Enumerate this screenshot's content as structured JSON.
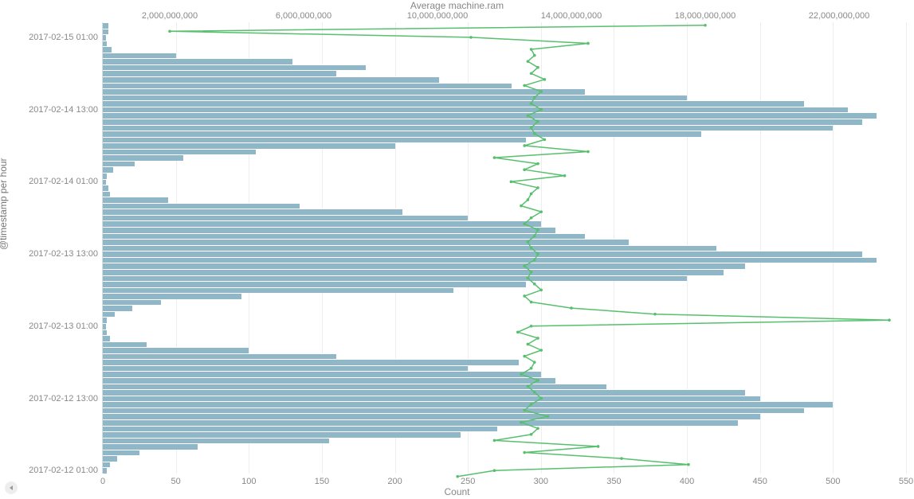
{
  "chart_data": {
    "type": "bar",
    "title_top": "Average machine.ram",
    "title_bottom": "Count",
    "title_y": "@timestamp per hour",
    "x_bottom": {
      "label": "Count",
      "min": 0,
      "max": 550,
      "ticks": [
        0,
        50,
        100,
        150,
        200,
        250,
        300,
        350,
        400,
        450,
        500,
        550
      ]
    },
    "x_top": {
      "label": "Average machine.ram",
      "min": 0,
      "max": 24000000000,
      "ticks": [
        2000000000,
        6000000000,
        10000000000,
        14000000000,
        18000000000,
        22000000000
      ],
      "tick_labels": [
        "2,000,000,000",
        "6,000,000,000",
        "10,000,000,000",
        "14,000,000,000",
        "18,000,000,000",
        "22,000,000,000"
      ]
    },
    "y_ticks": [
      "2017-02-15 01:00",
      "2017-02-14 13:00",
      "2017-02-14 01:00",
      "2017-02-13 13:00",
      "2017-02-13 01:00",
      "2017-02-12 13:00",
      "2017-02-12 01:00"
    ],
    "series": [
      {
        "name": "Count",
        "axis": "bottom",
        "kind": "bar",
        "color": "#90b7c7",
        "values": [
          4,
          4,
          2,
          3,
          6,
          50,
          130,
          180,
          160,
          230,
          280,
          330,
          400,
          480,
          510,
          530,
          520,
          500,
          410,
          290,
          200,
          105,
          55,
          22,
          7,
          3,
          2,
          4,
          5,
          45,
          135,
          205,
          250,
          300,
          310,
          330,
          360,
          420,
          520,
          530,
          440,
          425,
          400,
          290,
          240,
          95,
          40,
          20,
          8,
          3,
          2,
          3,
          5,
          30,
          100,
          160,
          285,
          250,
          300,
          310,
          345,
          440,
          450,
          500,
          480,
          450,
          435,
          270,
          245,
          155,
          65,
          25,
          10,
          5,
          3
        ]
      },
      {
        "name": "Average machine.ram",
        "axis": "top",
        "kind": "line",
        "color": "#57bf6d",
        "values": [
          18000000000,
          2000000000,
          11000000000,
          14500000000,
          12800000000,
          12900000000,
          12700000000,
          13000000000,
          12800000000,
          13200000000,
          12600000000,
          13100000000,
          12900000000,
          12800000000,
          13100000000,
          12700000000,
          13000000000,
          12800000000,
          12900000000,
          13200000000,
          12600000000,
          14500000000,
          11700000000,
          13000000000,
          12600000000,
          13800000000,
          12200000000,
          13000000000,
          12800000000,
          12700000000,
          12500000000,
          13100000000,
          12800000000,
          12600000000,
          13000000000,
          12900000000,
          12700000000,
          12800000000,
          13000000000,
          12900000000,
          12600000000,
          12800000000,
          12700000000,
          12900000000,
          13100000000,
          12600000000,
          12800000000,
          14000000000,
          16500000000,
          23500000000,
          12800000000,
          12400000000,
          13000000000,
          12700000000,
          13100000000,
          12600000000,
          12900000000,
          12800000000,
          12500000000,
          13000000000,
          12700000000,
          12900000000,
          13100000000,
          12800000000,
          12600000000,
          13300000000,
          12500000000,
          13000000000,
          12800000000,
          11700000000,
          14800000000,
          12600000000,
          15500000000,
          17500000000,
          11700000000,
          10600000000
        ]
      }
    ]
  }
}
